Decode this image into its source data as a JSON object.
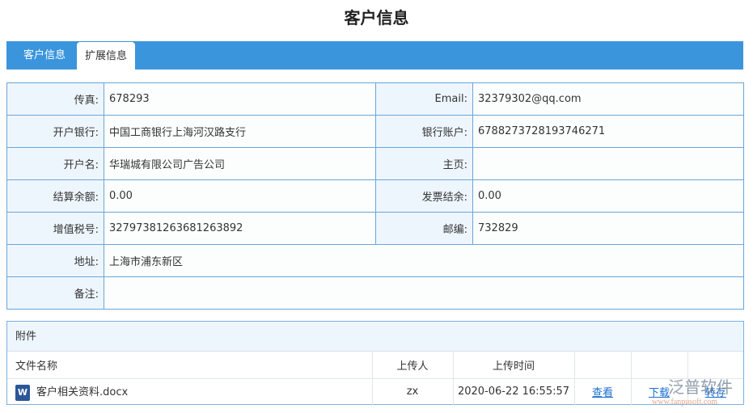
{
  "title": "客户信息",
  "tabs": [
    {
      "label": "客户信息"
    },
    {
      "label": "扩展信息",
      "active": true
    }
  ],
  "fields": {
    "fax": {
      "label": "传真:",
      "value": "678293"
    },
    "email": {
      "label": "Email:",
      "value": "32379302@qq.com"
    },
    "bank": {
      "label": "开户银行:",
      "value": "中国工商银行上海河汉路支行"
    },
    "account": {
      "label": "银行账户:",
      "value": "6788273728193746271"
    },
    "account_name": {
      "label": "开户名:",
      "value": "华瑞城有限公司广告公司"
    },
    "homepage": {
      "label": "主页:",
      "value": ""
    },
    "balance": {
      "label": "结算余额:",
      "value": "0.00"
    },
    "invoice_balance": {
      "label": "发票结余:",
      "value": "0.00"
    },
    "vat": {
      "label": "增值税号:",
      "value": "32797381263681263892"
    },
    "zip": {
      "label": "邮编:",
      "value": "732829"
    },
    "address": {
      "label": "地址:",
      "value": "上海市浦东新区"
    },
    "remark": {
      "label": "备注:",
      "value": ""
    }
  },
  "attachments": {
    "header": "附件",
    "columns": [
      "文件名称",
      "上传人",
      "上传时间",
      "",
      "",
      ""
    ],
    "rows": [
      {
        "icon": "word-doc-icon",
        "name": "客户相关资料.docx",
        "uploader": "zx",
        "time": "2020-06-22 16:55:57",
        "view": "查看",
        "download": "下载",
        "transfer": "转存"
      }
    ]
  },
  "watermark": {
    "brand": "泛普软件",
    "url": "www.fanpusoft.com"
  }
}
